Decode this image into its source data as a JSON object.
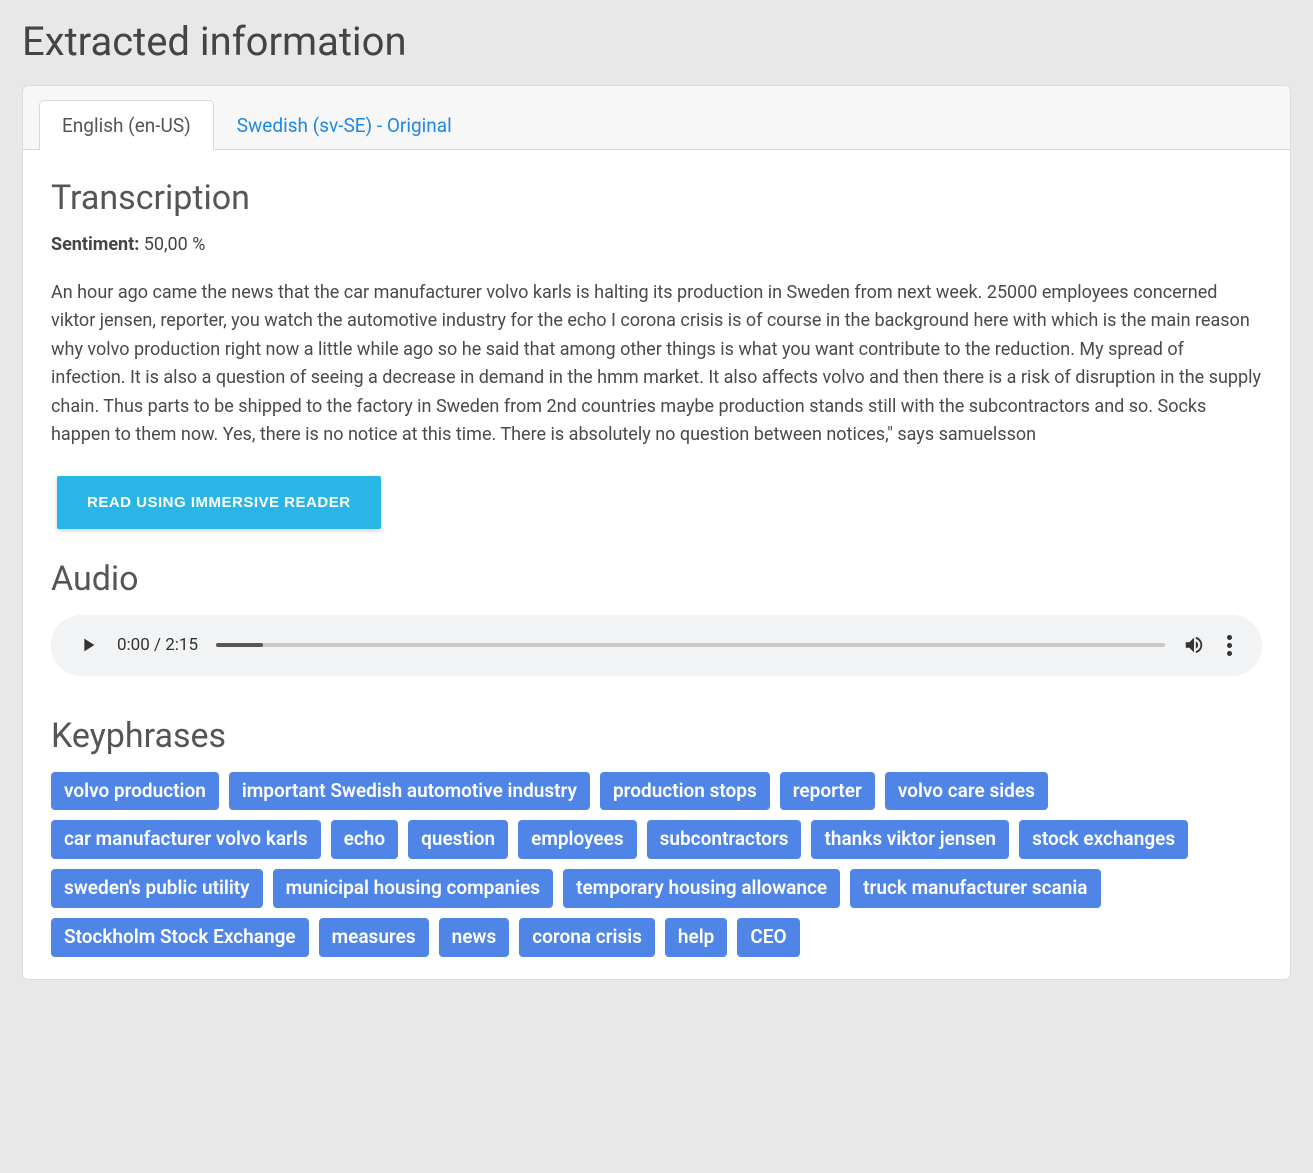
{
  "header": {
    "title": "Extracted information"
  },
  "tabs": [
    {
      "label": "English (en-US)",
      "active": true
    },
    {
      "label": "Swedish (sv-SE) - Original",
      "active": false
    }
  ],
  "transcription": {
    "title": "Transcription",
    "sentiment_label": "Sentiment:",
    "sentiment_value": "50,00 %",
    "body": "An hour ago came the news that the car manufacturer volvo karls is halting its production in Sweden from next week. 25000 employees concerned viktor jensen, reporter, you watch the automotive industry for the echo I corona crisis is of course in the background here with which is the main reason why volvo production right now a little while ago so he said that among other things is what you want contribute to the reduction. My spread of infection. It is also a question of seeing a decrease in demand in the hmm market. It also affects volvo and then there is a risk of disruption in the supply chain. Thus parts to be shipped to the factory in Sweden from 2nd countries maybe production stands still with the subcontractors and so. Socks happen to them now. Yes, there is no notice at this time. There is absolutely no question between notices,\" says samuelsson",
    "read_button": "READ USING IMMERSIVE READER"
  },
  "audio": {
    "title": "Audio",
    "current_time": "0:00",
    "duration": "2:15"
  },
  "keyphrases": {
    "title": "Keyphrases",
    "items": [
      "volvo production",
      "important Swedish automotive industry",
      "production stops",
      "reporter",
      "volvo care sides",
      "car manufacturer volvo karls",
      "echo",
      "question",
      "employees",
      "subcontractors",
      "thanks viktor jensen",
      "stock exchanges",
      "sweden's public utility",
      "municipal housing companies",
      "temporary housing allowance",
      "truck manufacturer scania",
      "Stockholm Stock Exchange",
      "measures",
      "news",
      "corona crisis",
      "help",
      "CEO"
    ]
  }
}
